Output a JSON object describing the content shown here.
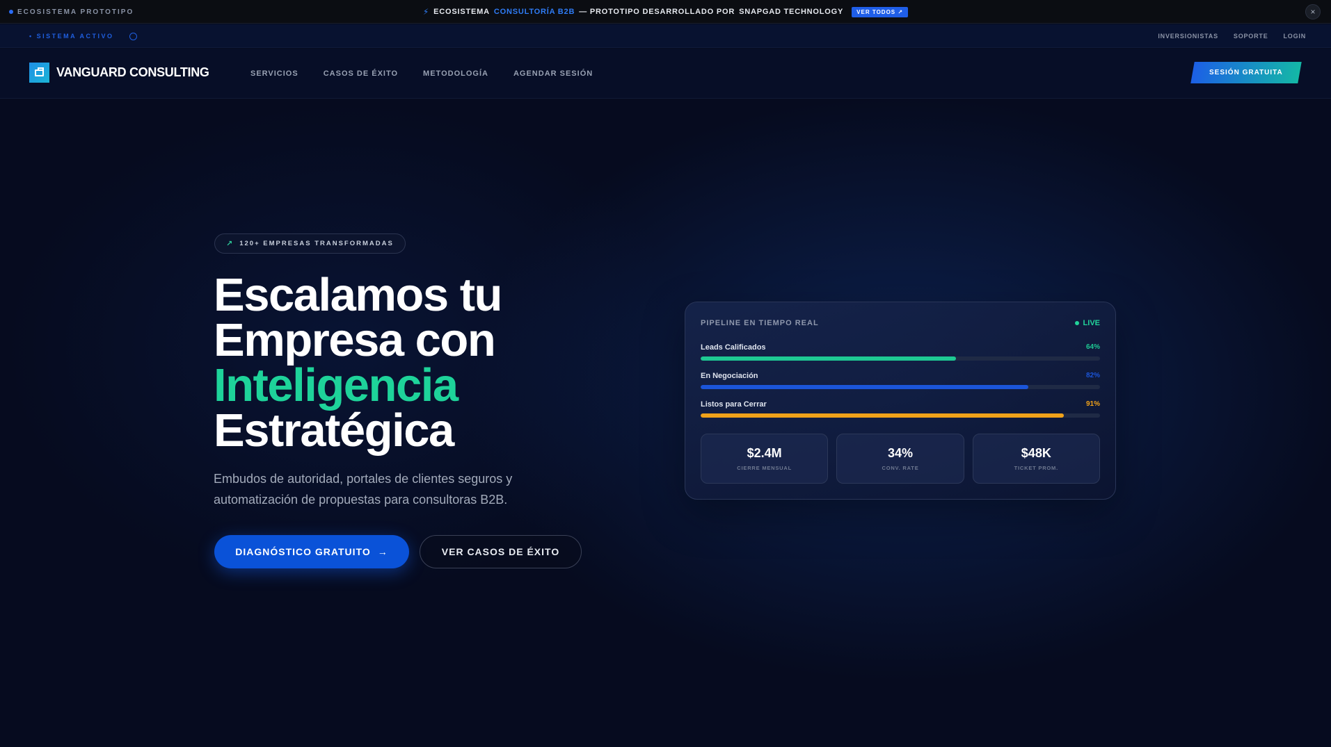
{
  "topbar": {
    "left_label": "ECOSISTEMA PROTOTIPO",
    "center_prefix": "ECOSISTEMA",
    "center_accent": "CONSULTORÍA B2B",
    "center_middle": "— PROTOTIPO DESARROLLADO POR",
    "center_brand": "SNAPGAD TECHNOLOGY",
    "view_all": "VER TODOS ↗",
    "close_icon": "×"
  },
  "utilbar": {
    "status": "• SISTEMA ACTIVO",
    "links": [
      "INVERSIONISTAS",
      "SOPORTE",
      "LOGIN"
    ]
  },
  "nav": {
    "brand": "VANGUARD CONSULTING",
    "links": [
      "SERVICIOS",
      "CASOS DE ÉXITO",
      "METODOLOGÍA",
      "AGENDAR SESIÓN"
    ],
    "cta": "SESIÓN GRATUITA"
  },
  "hero": {
    "badge": "120+ EMPRESAS TRANSFORMADAS",
    "title_line1": "Escalamos tu",
    "title_line2": "Empresa con",
    "title_line3": "Inteligencia",
    "title_line4": "Estratégica",
    "subtitle": "Embudos de autoridad, portales de clientes seguros y automatización de propuestas para consultoras B2B.",
    "primary_button": "DIAGNÓSTICO GRATUITO",
    "primary_arrow": "→",
    "secondary_button": "VER CASOS DE ÉXITO"
  },
  "pipeline": {
    "title": "PIPELINE EN TIEMPO REAL",
    "live": "LIVE",
    "metrics": [
      {
        "label": "Leads Calificados",
        "pct_text": "64%",
        "value": 64,
        "color": "#1ec993"
      },
      {
        "label": "En Negociación",
        "pct_text": "82%",
        "value": 82,
        "color": "#1b55d9"
      },
      {
        "label": "Listos para Cerrar",
        "pct_text": "91%",
        "value": 91,
        "color": "#f0a21a"
      }
    ],
    "stats": [
      {
        "value": "$2.4M",
        "label": "CIERRE MENSUAL"
      },
      {
        "value": "34%",
        "label": "CONV. RATE"
      },
      {
        "value": "$48K",
        "label": "TICKET PROM."
      }
    ]
  },
  "colors": {
    "accent_green": "#1ed39a",
    "accent_blue": "#0a52d8",
    "background": "#060b1f"
  }
}
